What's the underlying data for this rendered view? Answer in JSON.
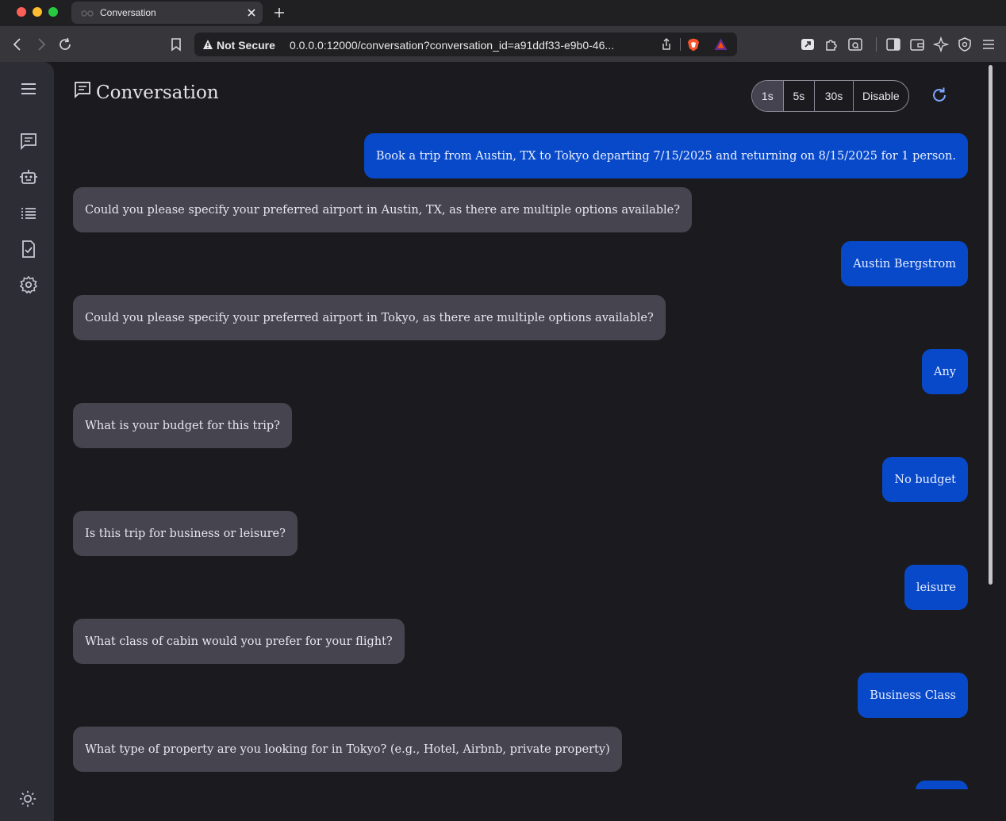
{
  "browser": {
    "tab_title": "Conversation",
    "security_label": "Not Secure",
    "url": "0.0.0.0:12000/conversation?conversation_id=a91ddf33-e9b0-46..."
  },
  "header": {
    "title": "Conversation",
    "refresh_options": [
      "1s",
      "5s",
      "30s",
      "Disable"
    ],
    "selected_refresh": "1s"
  },
  "sidebar": {
    "icons": [
      "menu-icon",
      "chat-icon",
      "robot-icon",
      "list-icon",
      "task-icon",
      "settings-icon",
      "theme-icon"
    ]
  },
  "messages": [
    {
      "role": "user",
      "text": "Book a trip from Austin, TX to Tokyo departing 7/15/2025 and returning on 8/15/2025 for 1 person."
    },
    {
      "role": "agent",
      "text": "Could you please specify your preferred airport in Austin, TX, as there are multiple options available?"
    },
    {
      "role": "user",
      "text": "Austin Bergstrom"
    },
    {
      "role": "agent",
      "text": "Could you please specify your preferred airport in Tokyo, as there are multiple options available?"
    },
    {
      "role": "user",
      "text": "Any"
    },
    {
      "role": "agent",
      "text": "What is your budget for this trip?"
    },
    {
      "role": "user",
      "text": "No budget"
    },
    {
      "role": "agent",
      "text": "Is this trip for business or leisure?"
    },
    {
      "role": "user",
      "text": "leisure"
    },
    {
      "role": "agent",
      "text": "What class of cabin would you prefer for your flight?"
    },
    {
      "role": "user",
      "text": "Business Class"
    },
    {
      "role": "agent",
      "text": "What type of property are you looking for in Tokyo? (e.g., Hotel, Airbnb, private property)"
    },
    {
      "role": "user",
      "text": ""
    }
  ],
  "colors": {
    "user_bubble": "#0749c9",
    "agent_bubble": "#46454f",
    "background": "#1b1b1f",
    "sidebar": "#2d2d35"
  }
}
